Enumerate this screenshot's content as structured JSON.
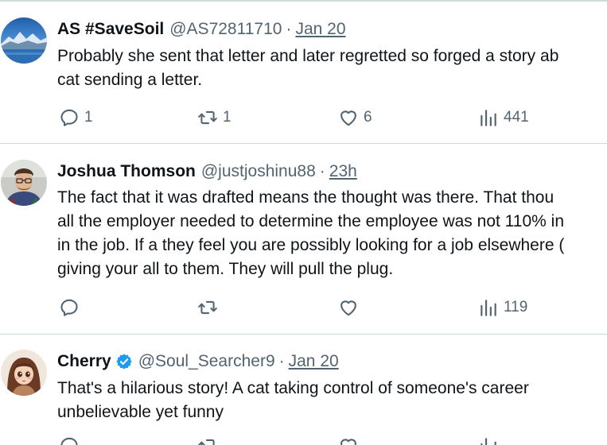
{
  "tweets": [
    {
      "display_name": "AS #SaveSoil",
      "handle": "@AS72811710",
      "separator": "·",
      "time": "Jan 20",
      "verified": false,
      "lines": [
        "Probably she sent that letter and later regretted so forged a story ab",
        "cat sending a letter."
      ],
      "actions": {
        "reply_count": "1",
        "retweet_count": "1",
        "like_count": "6",
        "views_count": "441"
      }
    },
    {
      "display_name": "Joshua Thomson",
      "handle": "@justjoshinu88",
      "separator": "·",
      "time": "23h",
      "verified": false,
      "lines": [
        "The fact that it was drafted means the thought was there. That thou",
        "all the employer needed to determine the employee was not 110% in",
        "in the job. If a they feel you are possibly looking for a job elsewhere (",
        "giving your all to them. They will pull the plug."
      ],
      "actions": {
        "reply_count": "",
        "retweet_count": "",
        "like_count": "",
        "views_count": "119"
      }
    },
    {
      "display_name": "Cherry",
      "handle": "@Soul_Searcher9",
      "separator": "·",
      "time": "Jan 20",
      "verified": true,
      "lines": [
        "That's a hilarious story! A cat taking control of someone's career",
        "unbelievable yet funny"
      ],
      "actions": {
        "reply_count": "",
        "retweet_count": "",
        "like_count": "",
        "views_count": ""
      }
    }
  ],
  "colors": {
    "text_primary": "#0f1419",
    "text_secondary": "#536471",
    "divider": "#cfd9de",
    "verified_blue": "#1d9bf0"
  }
}
